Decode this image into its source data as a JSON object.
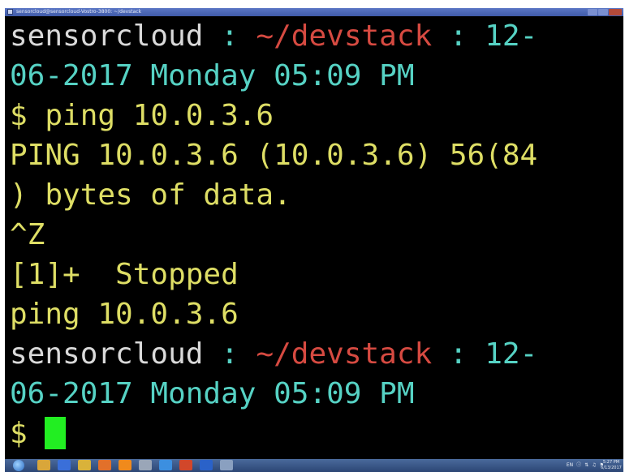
{
  "window": {
    "title": "sensorcloud@sensorcloud-Vostro-3800: ~/devstack"
  },
  "terminal": {
    "lines": [
      {
        "type": "prompt",
        "user": "sensorcloud",
        "sep1": " : ",
        "path": "~/devstack",
        "sep2": " : ",
        "date": "12-"
      },
      {
        "type": "text",
        "text": "06-2017 Monday 05:09 PM",
        "color": "cyan"
      },
      {
        "type": "text",
        "text": "$ ping 10.0.3.6",
        "color": "yellow"
      },
      {
        "type": "text",
        "text": "PING 10.0.3.6 (10.0.3.6) 56(84",
        "color": "yellow"
      },
      {
        "type": "text",
        "text": ") bytes of data.",
        "color": "yellow"
      },
      {
        "type": "text",
        "text": "^Z",
        "color": "yellow"
      },
      {
        "type": "text",
        "text": "[1]+  Stopped",
        "color": "yellow"
      },
      {
        "type": "text",
        "text": "ping 10.0.3.6",
        "color": "yellow"
      },
      {
        "type": "prompt",
        "user": "sensorcloud",
        "sep1": " : ",
        "path": "~/devstack",
        "sep2": " : ",
        "date": "12-"
      },
      {
        "type": "text",
        "text": "06-2017 Monday 05:09 PM",
        "color": "cyan"
      },
      {
        "type": "input",
        "prompt": "$ "
      }
    ]
  },
  "colors": {
    "background": "#000000",
    "user": "#d9d9d9",
    "separator": "#56d2c4",
    "path": "#d64a41",
    "output": "#dede65",
    "cursor": "#22ee22"
  },
  "taskbar": {
    "apps": [
      {
        "icon": "explorer-icon",
        "color": "#d9a63a"
      },
      {
        "icon": "media-player-icon",
        "color": "#3a6fd9"
      },
      {
        "icon": "folder-icon",
        "color": "#d9b23a"
      },
      {
        "icon": "firefox-icon",
        "color": "#e2702a"
      },
      {
        "icon": "vlc-icon",
        "color": "#f08a1c"
      },
      {
        "icon": "settings-icon",
        "color": "#9aa6b8"
      },
      {
        "icon": "internet-explorer-icon",
        "color": "#3c8fe0"
      },
      {
        "icon": "powerpoint-icon",
        "color": "#d2472a"
      },
      {
        "icon": "teamviewer-icon",
        "color": "#2a62c9"
      },
      {
        "icon": "putty-icon",
        "color": "#8aa0c0"
      }
    ],
    "tray_language": "EN",
    "clock_time": "5:27 PM",
    "clock_date": "6/13/2017"
  }
}
